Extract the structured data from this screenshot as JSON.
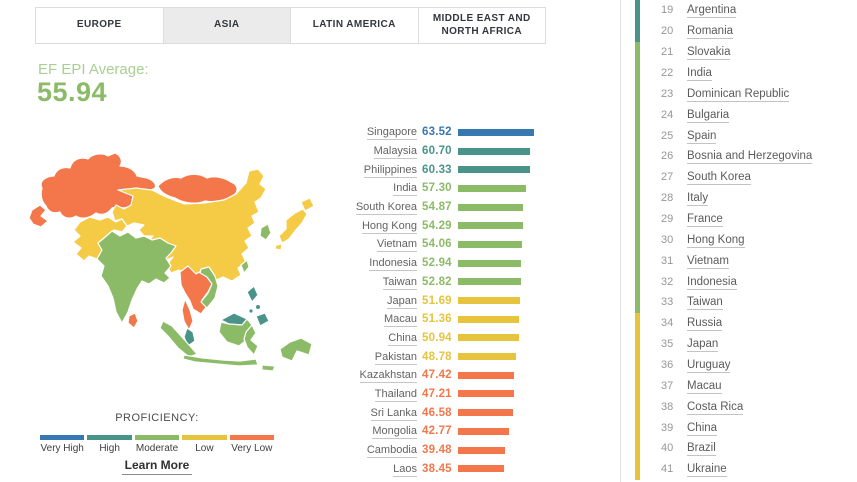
{
  "tabs": [
    {
      "label": "EUROPE",
      "active": false
    },
    {
      "label": "ASIA",
      "active": true
    },
    {
      "label": "LATIN AMERICA",
      "active": false
    },
    {
      "label": "MIDDLE EAST AND NORTH AFRICA",
      "active": false
    }
  ],
  "average": {
    "label": "EF EPI Average:",
    "value": "55.94"
  },
  "colors": {
    "very_high": "#3778b1",
    "high": "#4a9389",
    "moderate": "#8cbb68",
    "low": "#e6c43e",
    "very_low": "#f3774b"
  },
  "chart_data": {
    "type": "bar",
    "title": "EF EPI Average:",
    "region": "Asia",
    "average": 55.94,
    "categories": [
      "Singapore",
      "Malaysia",
      "Philippines",
      "India",
      "South Korea",
      "Hong Kong",
      "Vietnam",
      "Indonesia",
      "Taiwan",
      "Japan",
      "Macau",
      "China",
      "Pakistan",
      "Kazakhstan",
      "Thailand",
      "Sri Lanka",
      "Mongolia",
      "Cambodia",
      "Laos"
    ],
    "values": [
      63.52,
      60.7,
      60.33,
      57.3,
      54.87,
      54.29,
      54.06,
      52.94,
      52.82,
      51.69,
      51.36,
      50.94,
      48.78,
      47.42,
      47.21,
      46.58,
      42.77,
      39.48,
      38.45
    ],
    "bands": [
      "very_high",
      "high",
      "high",
      "moderate",
      "moderate",
      "moderate",
      "moderate",
      "moderate",
      "moderate",
      "low",
      "low",
      "low",
      "low",
      "very_low",
      "very_low",
      "very_low",
      "very_low",
      "very_low",
      "very_low"
    ],
    "xlim": [
      0,
      100
    ],
    "legend_position": "bottom-left"
  },
  "legend": {
    "title": "PROFICIENCY:",
    "items": [
      {
        "label": "Very High",
        "band": "very_high"
      },
      {
        "label": "High",
        "band": "high"
      },
      {
        "label": "Moderate",
        "band": "moderate"
      },
      {
        "label": "Low",
        "band": "low"
      },
      {
        "label": "Very Low",
        "band": "very_low"
      }
    ],
    "learn_more": "Learn More"
  },
  "ranking": {
    "items": [
      {
        "rank": 19,
        "country": "Argentina",
        "band": "high"
      },
      {
        "rank": 20,
        "country": "Romania",
        "band": "high"
      },
      {
        "rank": 21,
        "country": "Slovakia",
        "band": "moderate"
      },
      {
        "rank": 22,
        "country": "India",
        "band": "moderate"
      },
      {
        "rank": 23,
        "country": "Dominican Republic",
        "band": "moderate"
      },
      {
        "rank": 24,
        "country": "Bulgaria",
        "band": "moderate"
      },
      {
        "rank": 25,
        "country": "Spain",
        "band": "moderate"
      },
      {
        "rank": 26,
        "country": "Bosnia and Herzegovina",
        "band": "moderate"
      },
      {
        "rank": 27,
        "country": "South Korea",
        "band": "moderate"
      },
      {
        "rank": 28,
        "country": "Italy",
        "band": "moderate"
      },
      {
        "rank": 29,
        "country": "France",
        "band": "moderate"
      },
      {
        "rank": 30,
        "country": "Hong Kong",
        "band": "moderate"
      },
      {
        "rank": 31,
        "country": "Vietnam",
        "band": "moderate"
      },
      {
        "rank": 32,
        "country": "Indonesia",
        "band": "moderate"
      },
      {
        "rank": 33,
        "country": "Taiwan",
        "band": "moderate"
      },
      {
        "rank": 34,
        "country": "Russia",
        "band": "low"
      },
      {
        "rank": 35,
        "country": "Japan",
        "band": "low"
      },
      {
        "rank": 36,
        "country": "Uruguay",
        "band": "low"
      },
      {
        "rank": 37,
        "country": "Macau",
        "band": "low"
      },
      {
        "rank": 38,
        "country": "Costa Rica",
        "band": "low"
      },
      {
        "rank": 39,
        "country": "China",
        "band": "low"
      },
      {
        "rank": 40,
        "country": "Brazil",
        "band": "low"
      },
      {
        "rank": 41,
        "country": "Ukraine",
        "band": "low"
      }
    ]
  },
  "map": {
    "region": "Asia",
    "countries": [
      {
        "name": "Kazakhstan",
        "band": "very_low"
      },
      {
        "name": "Mongolia",
        "band": "very_low"
      },
      {
        "name": "China",
        "band": "low"
      },
      {
        "name": "Pakistan",
        "band": "low"
      },
      {
        "name": "Japan",
        "band": "low"
      },
      {
        "name": "South Korea",
        "band": "moderate"
      },
      {
        "name": "Taiwan",
        "band": "moderate"
      },
      {
        "name": "India",
        "band": "moderate"
      },
      {
        "name": "Sri Lanka",
        "band": "very_low"
      },
      {
        "name": "Thailand",
        "band": "very_low"
      },
      {
        "name": "Laos",
        "band": "very_low"
      },
      {
        "name": "Cambodia",
        "band": "very_low"
      },
      {
        "name": "Vietnam",
        "band": "moderate"
      },
      {
        "name": "Malaysia",
        "band": "high"
      },
      {
        "name": "Indonesia",
        "band": "moderate"
      },
      {
        "name": "Philippines",
        "band": "high"
      }
    ]
  }
}
